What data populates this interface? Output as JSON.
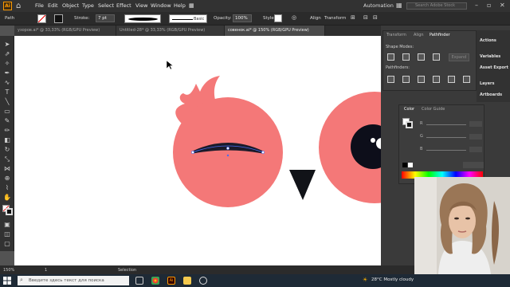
{
  "menubar": {
    "logo": "Ai",
    "home_icon": "home-icon",
    "items": [
      "File",
      "Edit",
      "Object",
      "Type",
      "Select",
      "Effect",
      "View",
      "Window",
      "Help"
    ],
    "workspace": "Automation",
    "search_placeholder": "Search Adobe Stock"
  },
  "controlbar": {
    "selection": "Path",
    "stroke_label": "Stroke:",
    "stroke_value": "7 pt",
    "profile_label": "Basic",
    "opacity_label": "Opacity:",
    "opacity_value": "100%",
    "style_label": "Style:",
    "align_label": "Align",
    "transform_label": "Transform"
  },
  "tabs": [
    {
      "label": "узоров.ai* @ 33,33% (RGB/GPU Preview)",
      "active": false
    },
    {
      "label": "Untitled-28* @ 33,33% (RGB/GPU Preview)",
      "active": false
    },
    {
      "label": "совенок.ai* @ 150% (RGB/GPU Preview)",
      "active": true
    }
  ],
  "panels": {
    "top_tabs": [
      "Transform",
      "Align",
      "Pathfinder"
    ],
    "shape_modes_label": "Shape Modes:",
    "pathfinders_label": "Pathfinders:",
    "expand_label": "Expand",
    "right_strip": [
      "Actions",
      "Variables",
      "Asset Export",
      "Layers",
      "Artboards"
    ],
    "color_tabs": [
      "Color",
      "Color Guide"
    ],
    "color_channels": [
      "R",
      "G",
      "B"
    ]
  },
  "status": {
    "zoom": "150%",
    "page": "1",
    "tool": "Selection"
  },
  "taskbar": {
    "search_placeholder": "Введите здесь текст для поиска",
    "weather": "28°C  Mostly cloudy"
  },
  "colors": {
    "owl_pink": "#f47878",
    "pupil": "#0d0e1a",
    "beak": "#111318",
    "accent": "#ff9a00"
  }
}
